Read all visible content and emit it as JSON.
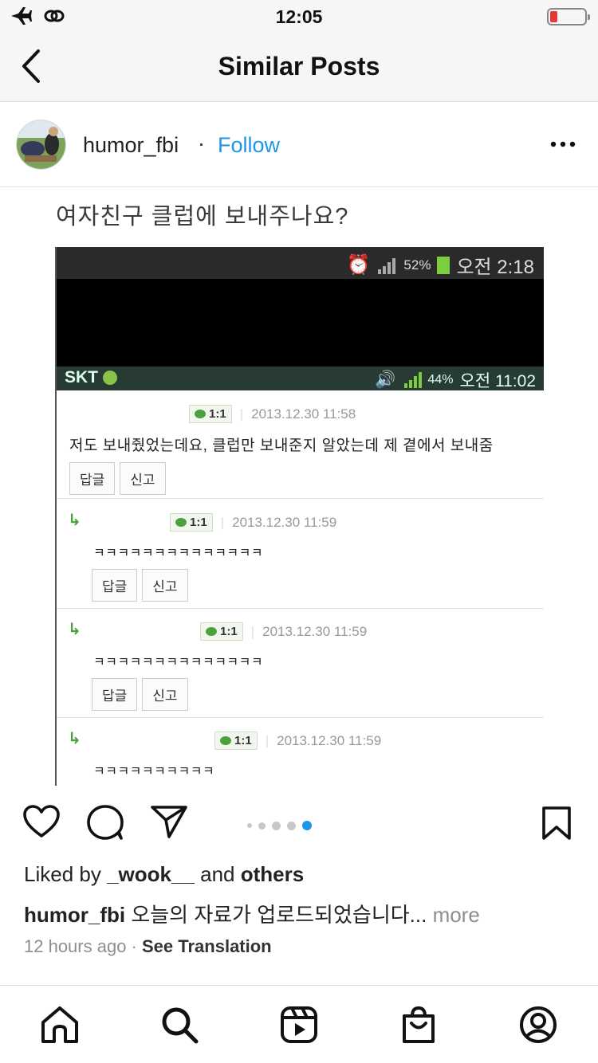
{
  "status_bar": {
    "time": "12:05",
    "icons": [
      "airplane-icon",
      "link-icon",
      "battery-low-icon"
    ],
    "battery_color": "#e53935"
  },
  "nav": {
    "title": "Similar Posts",
    "back_icon": "chevron-left-icon"
  },
  "post": {
    "username": "humor_fbi",
    "separator": "·",
    "follow_label": "Follow",
    "follow_color": "#1e96e8",
    "more_icon": "ellipsis-icon",
    "image": {
      "heading": "여자친구 클럽에 보내주나요?",
      "top_status": {
        "battery": "52%",
        "time": "오전 2:18"
      },
      "second_status": {
        "carrier": "SKT",
        "battery": "44%",
        "time": "오전 11:02"
      },
      "comments": [
        {
          "badge": "1:1",
          "date": "2013.12.30 11:58",
          "text": "저도 보내줬었는데요, 클럽만 보내준지 알았는데 제 곁에서 보내줌",
          "buttons": [
            "답글",
            "신고"
          ]
        },
        {
          "badge": "1:1",
          "date": "2013.12.30 11:59",
          "text": "ㅋㅋㅋㅋㅋㅋㅋㅋㅋㅋㅋㅋㅋㅋ",
          "buttons": [
            "답글",
            "신고"
          ]
        },
        {
          "badge": "1:1",
          "date": "2013.12.30 11:59",
          "text": "ㅋㅋㅋㅋㅋㅋㅋㅋㅋㅋㅋㅋㅋㅋ",
          "buttons": [
            "답글",
            "신고"
          ]
        },
        {
          "badge": "1:1",
          "date": "2013.12.30 11:59",
          "text": "ㅋㅋㅋㅋㅋㅋㅋㅋㅋㅋ",
          "buttons": []
        }
      ]
    },
    "carousel": {
      "count": 5,
      "active_index": 4,
      "active_color": "#1e96e8"
    },
    "actions": [
      "heart-icon",
      "comment-icon",
      "share-icon",
      "bookmark-icon"
    ],
    "likes": {
      "prefix": "Liked by ",
      "user": "_wook__",
      "middle": " and ",
      "suffix": "others"
    },
    "caption": {
      "user": "humor_fbi",
      "text": " 오늘의 자료가 업로드되었습니다...",
      "more": " more"
    },
    "time_ago": "12 hours ago",
    "dot": " · ",
    "see_translation": "See Translation"
  },
  "tab_bar": {
    "items": [
      "home-icon",
      "search-icon",
      "reels-icon",
      "shop-icon",
      "profile-icon"
    ]
  }
}
